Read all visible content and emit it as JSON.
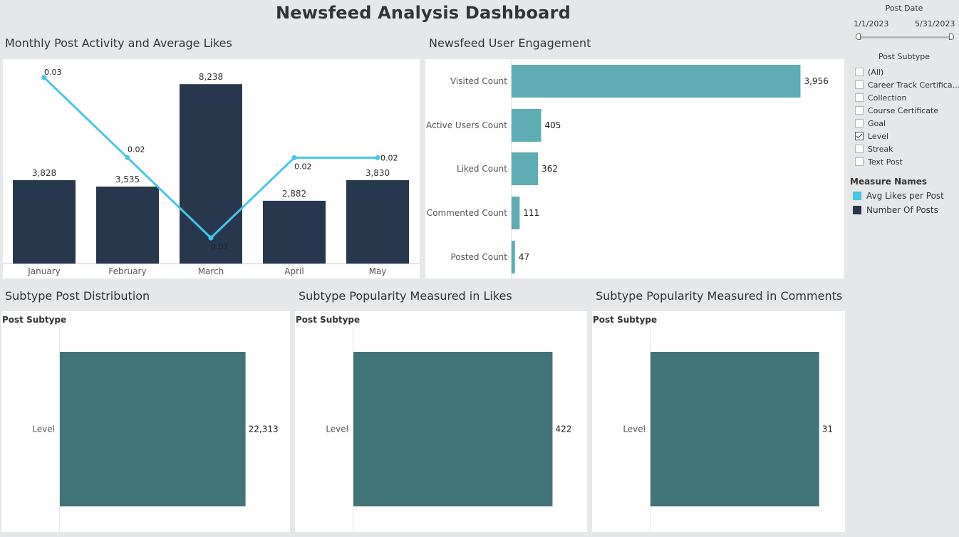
{
  "dashboard": {
    "title": "Newsfeed Analysis Dashboard"
  },
  "filters": {
    "post_date": {
      "label": "Post Date",
      "start": "1/1/2023",
      "end": "5/31/2023"
    },
    "post_subtype": {
      "label": "Post Subtype",
      "options": [
        {
          "label": "(All)",
          "checked": false
        },
        {
          "label": "Career Track Certifica...",
          "checked": false
        },
        {
          "label": "Collection",
          "checked": false
        },
        {
          "label": "Course Certificate",
          "checked": false
        },
        {
          "label": "Goal",
          "checked": false
        },
        {
          "label": "Level",
          "checked": true
        },
        {
          "label": "Streak",
          "checked": false
        },
        {
          "label": "Text Post",
          "checked": false
        }
      ]
    }
  },
  "legend": {
    "title": "Measure Names",
    "items": [
      {
        "label": "Avg Likes per Post",
        "color": "#47c6e6"
      },
      {
        "label": "Number Of Posts",
        "color": "#27384e"
      }
    ]
  },
  "chart_data": [
    {
      "type": "bar",
      "title": "Monthly Post Activity and Average Likes",
      "categories": [
        "January",
        "February",
        "March",
        "April",
        "May"
      ],
      "series": [
        {
          "name": "Number Of Posts",
          "values": [
            3828,
            3535,
            8238,
            2882,
            3830
          ],
          "labels": [
            "3,828",
            "3,535",
            "8,238",
            "2,882",
            "3,830"
          ],
          "color": "#27384e"
        },
        {
          "name": "Avg Likes per Post",
          "type": "line",
          "values": [
            0.03,
            0.02,
            0.01,
            0.02,
            0.02
          ],
          "labels": [
            "0.03",
            "0.02",
            "0.01",
            "0.02",
            "0.02"
          ],
          "color": "#47c6e6"
        }
      ],
      "ylim": [
        0,
        8800
      ],
      "ylim_secondary": [
        0.0068,
        0.0307
      ],
      "grid": false
    },
    {
      "type": "bar",
      "orientation": "horizontal",
      "title": "Newsfeed User Engagement",
      "categories": [
        "Visited Count",
        "Active Users Count",
        "Liked Count",
        "Commented Count",
        "Posted Count"
      ],
      "values": [
        3956,
        405,
        362,
        111,
        47
      ],
      "labels": [
        "3,956",
        "405",
        "362",
        "111",
        "47"
      ],
      "color": "#5eadb5",
      "xlim": [
        0,
        4000
      ]
    },
    {
      "type": "bar",
      "orientation": "horizontal",
      "title": "Subtype Post Distribution",
      "row_header": "Post Subtype",
      "categories": [
        "Level"
      ],
      "values": [
        22313
      ],
      "labels": [
        "22,313"
      ],
      "color": "#417478",
      "xlim": [
        0,
        25000
      ]
    },
    {
      "type": "bar",
      "orientation": "horizontal",
      "title": "Subtype Popularity Measured in Likes",
      "row_header": "Post Subtype",
      "categories": [
        "Level"
      ],
      "values": [
        422
      ],
      "labels": [
        "422"
      ],
      "color": "#417478",
      "xlim": [
        0,
        450
      ]
    },
    {
      "type": "bar",
      "orientation": "horizontal",
      "title": "Subtype Popularity Measured in Comments",
      "row_header": "Post Subtype",
      "categories": [
        "Level"
      ],
      "values": [
        31
      ],
      "labels": [
        "31"
      ],
      "color": "#417478",
      "xlim": [
        0,
        33
      ]
    }
  ]
}
